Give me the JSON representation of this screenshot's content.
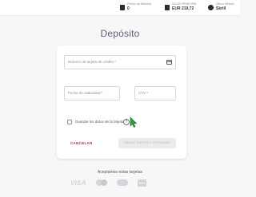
{
  "header": {
    "stats": [
      {
        "label": "Puntos de fidelidad",
        "value": "0",
        "icon": "loyalty-icon"
      },
      {
        "label": "SALDO PRINCIPAL",
        "value": "EUR 219,72",
        "icon": "wallet-icon"
      },
      {
        "label": "Último Método",
        "value": "Skrill",
        "icon": "method-icon"
      }
    ]
  },
  "page": {
    "title": "Depósito"
  },
  "form": {
    "card_number_placeholder": "Número de tarjeta de crédito *",
    "expiry_placeholder": "Fecha de caducidad *",
    "cvv_placeholder": "CVV *",
    "save_card_label": "Guardar los datos de la tarjeta",
    "help_glyph": "?",
    "cancel_label": "CANCELAR",
    "submit_label": "AÑADIR TARJETA Y CONTINUAR"
  },
  "footer": {
    "accept_label": "Aceptamos estas tarjetas",
    "visa_text": "VISA",
    "logos": [
      "visa",
      "mastercard",
      "maestro",
      "generic-card"
    ]
  },
  "colors": {
    "accent": "#a12d4a",
    "title": "#6a5a78",
    "cursor": "#2e9e3e"
  }
}
